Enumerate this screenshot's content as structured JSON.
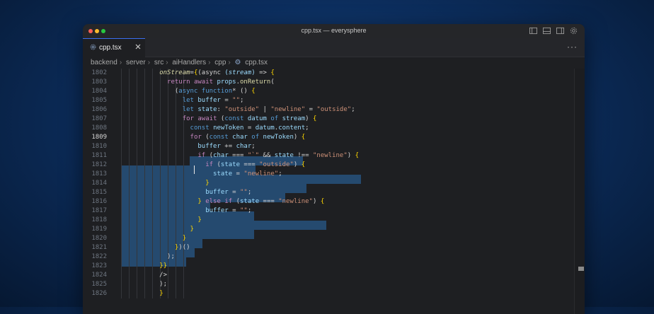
{
  "window": {
    "title": "cpp.tsx — everysphere",
    "traffic_lights": [
      "#ff5f57",
      "#febc2e",
      "#28c840"
    ]
  },
  "tab": {
    "label": "cpp.tsx",
    "icon": "gear-file-icon"
  },
  "breadcrumb": [
    "backend",
    "server",
    "src",
    "aiHandlers",
    "cpp",
    "cpp.tsx"
  ],
  "editor": {
    "active_line": "1809",
    "lines": [
      {
        "n": "1802",
        "html": "<span class=\"fn\" style=\"font-style:italic\">onStream</span>=<span class=\"pun\">{</span>(async <span class=\"var\">(</span><span class=\"var\" style=\"font-style:italic\">stream</span><span class=\"var\">)</span> =&gt; <span class=\"pun\">{</span>"
      },
      {
        "n": "1803",
        "html": "  <span class=\"kw\">return</span> <span class=\"kw\">await</span> <span class=\"var\">props</span>.<span class=\"fn\">onReturn</span>("
      },
      {
        "n": "1804",
        "html": "    (<span class=\"kb\">async</span> <span class=\"kb\">function</span>* () <span class=\"pun\">{</span>"
      },
      {
        "n": "1805",
        "html": "      <span class=\"kb\">let</span> <span class=\"var\">buffer</span> = <span class=\"str\">\"\"</span>;"
      },
      {
        "n": "1806",
        "html": "      <span class=\"kb\">let</span> <span class=\"var\">state</span>: <span class=\"str\">\"outside\"</span> | <span class=\"str\">\"newline\"</span> = <span class=\"str\">\"outside\"</span>;"
      },
      {
        "n": "1807",
        "html": "      <span class=\"kw\">for</span> <span class=\"kw\">await</span> (<span class=\"kb\">const</span> <span class=\"var\">datum</span> <span class=\"kb\">of</span> <span class=\"var\">stream</span>) <span class=\"pun\">{</span>"
      },
      {
        "n": "1808",
        "html": "        <span class=\"kb\">const</span> <span class=\"var\">newToken</span> = <span class=\"var\">datum</span>.<span class=\"var\">content</span>;"
      },
      {
        "n": "1809",
        "html": "        <span class=\"kw\">for</span> (<span class=\"kb\">const</span> <span class=\"var\">char</span> <span class=\"kb\">of</span> <span class=\"var\">newToken</span>) <span class=\"pun\">{</span>"
      },
      {
        "n": "1810",
        "html": "          <span class=\"var\">buffer</span> += <span class=\"var\">char</span>;"
      },
      {
        "n": "1811",
        "html": "          <span class=\"kw\">if</span> (<span class=\"var\">char</span> === <span class=\"str\">\"`\"</span> &amp;&amp; <span class=\"var\">state</span> !== <span class=\"str\">\"newline\"</span>) <span class=\"pun\">{</span>"
      },
      {
        "n": "1812",
        "html": "            <span class=\"kw\">if</span> (<span class=\"var\">state</span> === <span class=\"str\">\"outside\"</span>) <span class=\"pun\">{</span>"
      },
      {
        "n": "1813",
        "html": "              <span class=\"var\">state</span> = <span class=\"str\">\"newline\"</span>;"
      },
      {
        "n": "1814",
        "html": "            <span class=\"pun\">}</span>"
      },
      {
        "n": "1815",
        "html": "            <span class=\"var\">buffer</span> = <span class=\"str\">\"\"</span>;"
      },
      {
        "n": "1816",
        "html": "          <span class=\"pun\">}</span> <span class=\"kw\">else</span> <span class=\"kw\">if</span> (<span class=\"var\">state</span> === <span class=\"str\">\"newline\"</span>) <span class=\"pun\">{</span>"
      },
      {
        "n": "1817",
        "html": "            <span class=\"var\">buffer</span> = <span class=\"str\">\"\"</span>;"
      },
      {
        "n": "1818",
        "html": "          <span class=\"pun\">}</span>"
      },
      {
        "n": "1819",
        "html": "        <span class=\"pun\">}</span>"
      },
      {
        "n": "1820",
        "html": "      <span class=\"pun\">}</span>"
      },
      {
        "n": "1821",
        "html": "    <span class=\"pun\">}</span>)()"
      },
      {
        "n": "1822",
        "html": "  );"
      },
      {
        "n": "1823",
        "html": "<span class=\"pun\">}</span><span class=\"pun\">}</span>"
      },
      {
        "n": "1824",
        "html": "/&gt;"
      },
      {
        "n": "1825",
        "html": ");"
      },
      {
        "n": "1826",
        "html": "<span class=\"pun\">}</span>"
      }
    ]
  }
}
